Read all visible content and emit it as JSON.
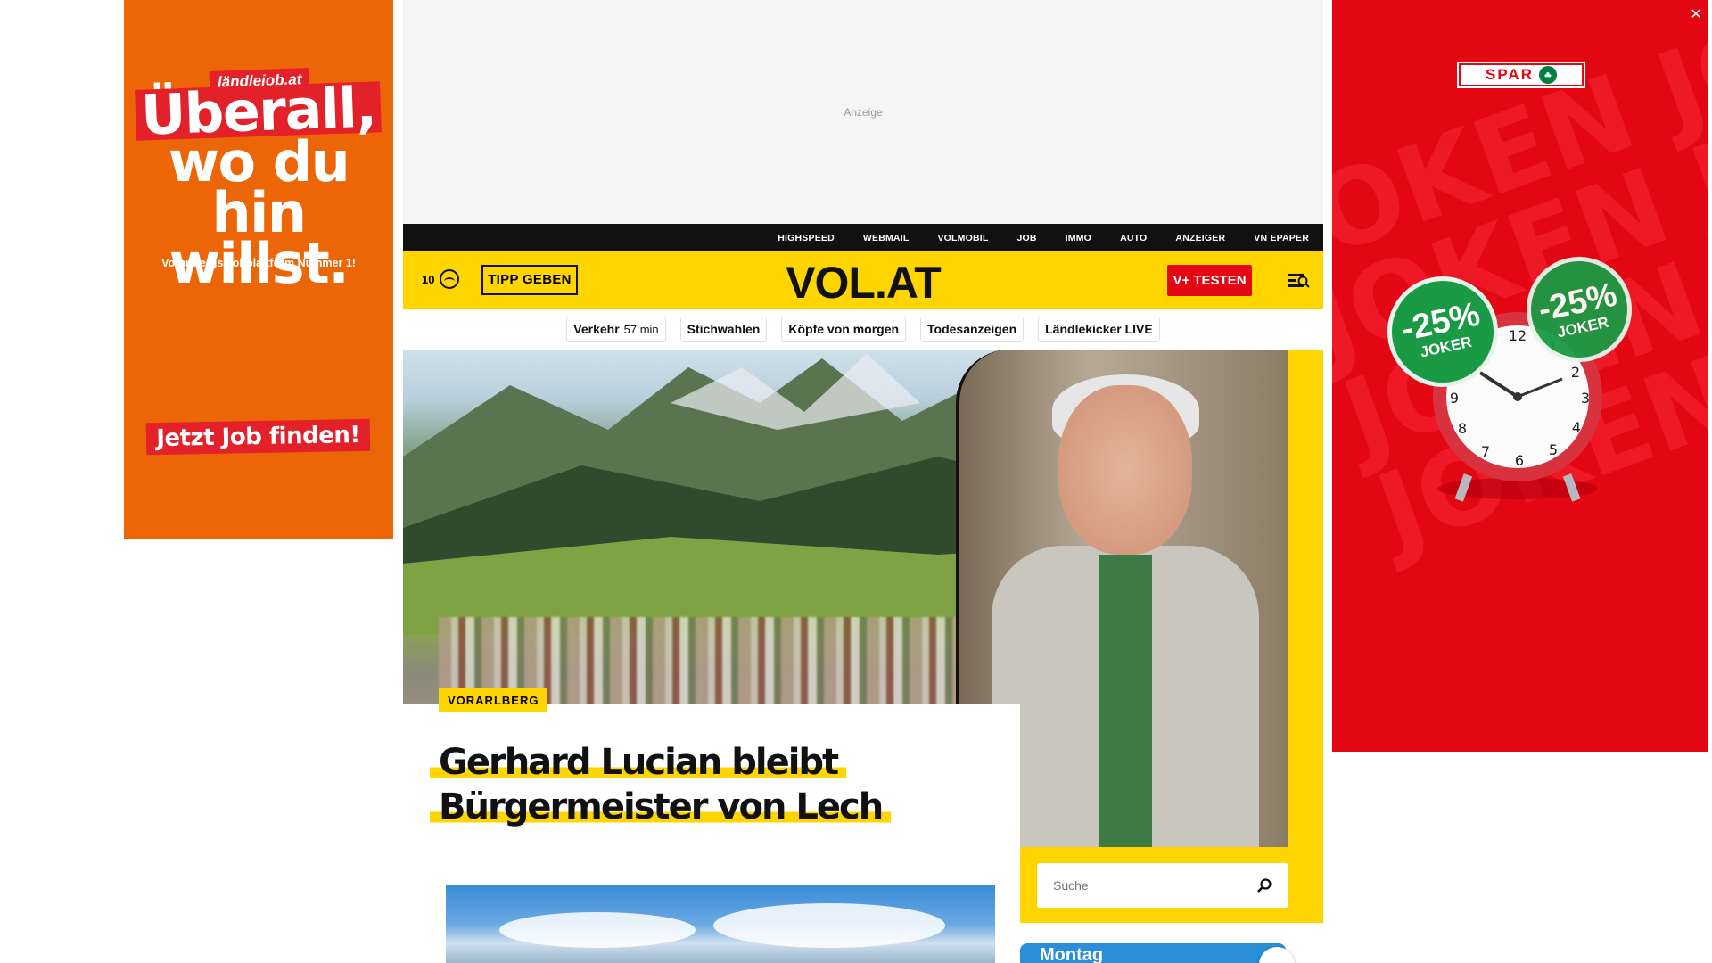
{
  "ads": {
    "left": {
      "brand": "ländlejob.at",
      "headline_lines": [
        "Überall,",
        "wo du hin",
        "willst."
      ],
      "subline": "Vorarlbergs Jobplattform Nummer 1!",
      "cta": "Jetzt Job finden!",
      "bg_color": "#ec6608"
    },
    "right": {
      "brand": "SPAR",
      "bg_word": "JOKEN JOKEN JOKEN",
      "badge_percent": "-25%",
      "badge_label": "JOKER",
      "close_symbol": "✕",
      "bg_color": "#e30613"
    },
    "top": {
      "label": "Anzeige"
    }
  },
  "topbar": {
    "links": [
      "HIGHSPEED",
      "WEBMAIL",
      "VOLMOBIL",
      "JOB",
      "IMMO",
      "AUTO",
      "ANZEIGER",
      "VN EPAPER"
    ]
  },
  "header": {
    "weather_temp": "10",
    "tipp_label": "TIPP GEBEN",
    "logo": "VOL.AT",
    "vplus_label": "V+ TESTEN",
    "accent_color": "#ffd500"
  },
  "quicklinks": [
    {
      "label": "Verkehr",
      "extra": "57 min"
    },
    {
      "label": "Stichwahlen",
      "extra": ""
    },
    {
      "label": "Köpfe von morgen",
      "extra": ""
    },
    {
      "label": "Todesanzeigen",
      "extra": ""
    },
    {
      "label": "Ländlekicker LIVE",
      "extra": ""
    }
  ],
  "hero": {
    "kicker": "VORARLBERG",
    "headline_line1": "Gerhard Lucian bleibt",
    "headline_line2": "Bürgermeister von Lech"
  },
  "search": {
    "placeholder": "Suche"
  },
  "teaser": {
    "day": "Montag"
  }
}
